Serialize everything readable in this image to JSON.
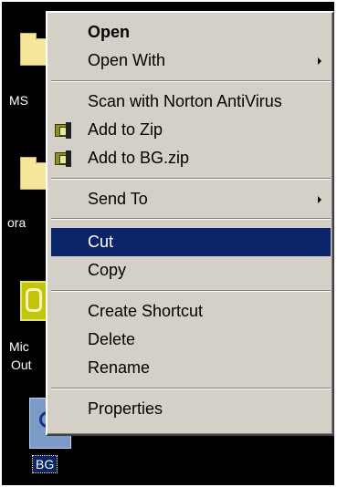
{
  "desktop": {
    "icons": [
      {
        "label": "MS"
      },
      {
        "label": "ora"
      },
      {
        "label": "Mic"
      },
      {
        "label": "Out"
      },
      {
        "label": "BG"
      }
    ]
  },
  "context_menu": {
    "items": [
      {
        "label": "Open"
      },
      {
        "label": "Open With"
      },
      {
        "label": "Scan with Norton AntiVirus"
      },
      {
        "label": "Add to Zip"
      },
      {
        "label": "Add to BG.zip"
      },
      {
        "label": "Send To"
      },
      {
        "label": "Cut"
      },
      {
        "label": "Copy"
      },
      {
        "label": "Create Shortcut"
      },
      {
        "label": "Delete"
      },
      {
        "label": "Rename"
      },
      {
        "label": "Properties"
      }
    ],
    "selected_item": "Cut"
  },
  "colors": {
    "menu_background": "#d4d0c8",
    "selection": "#0a246a",
    "desktop": "#000000"
  }
}
